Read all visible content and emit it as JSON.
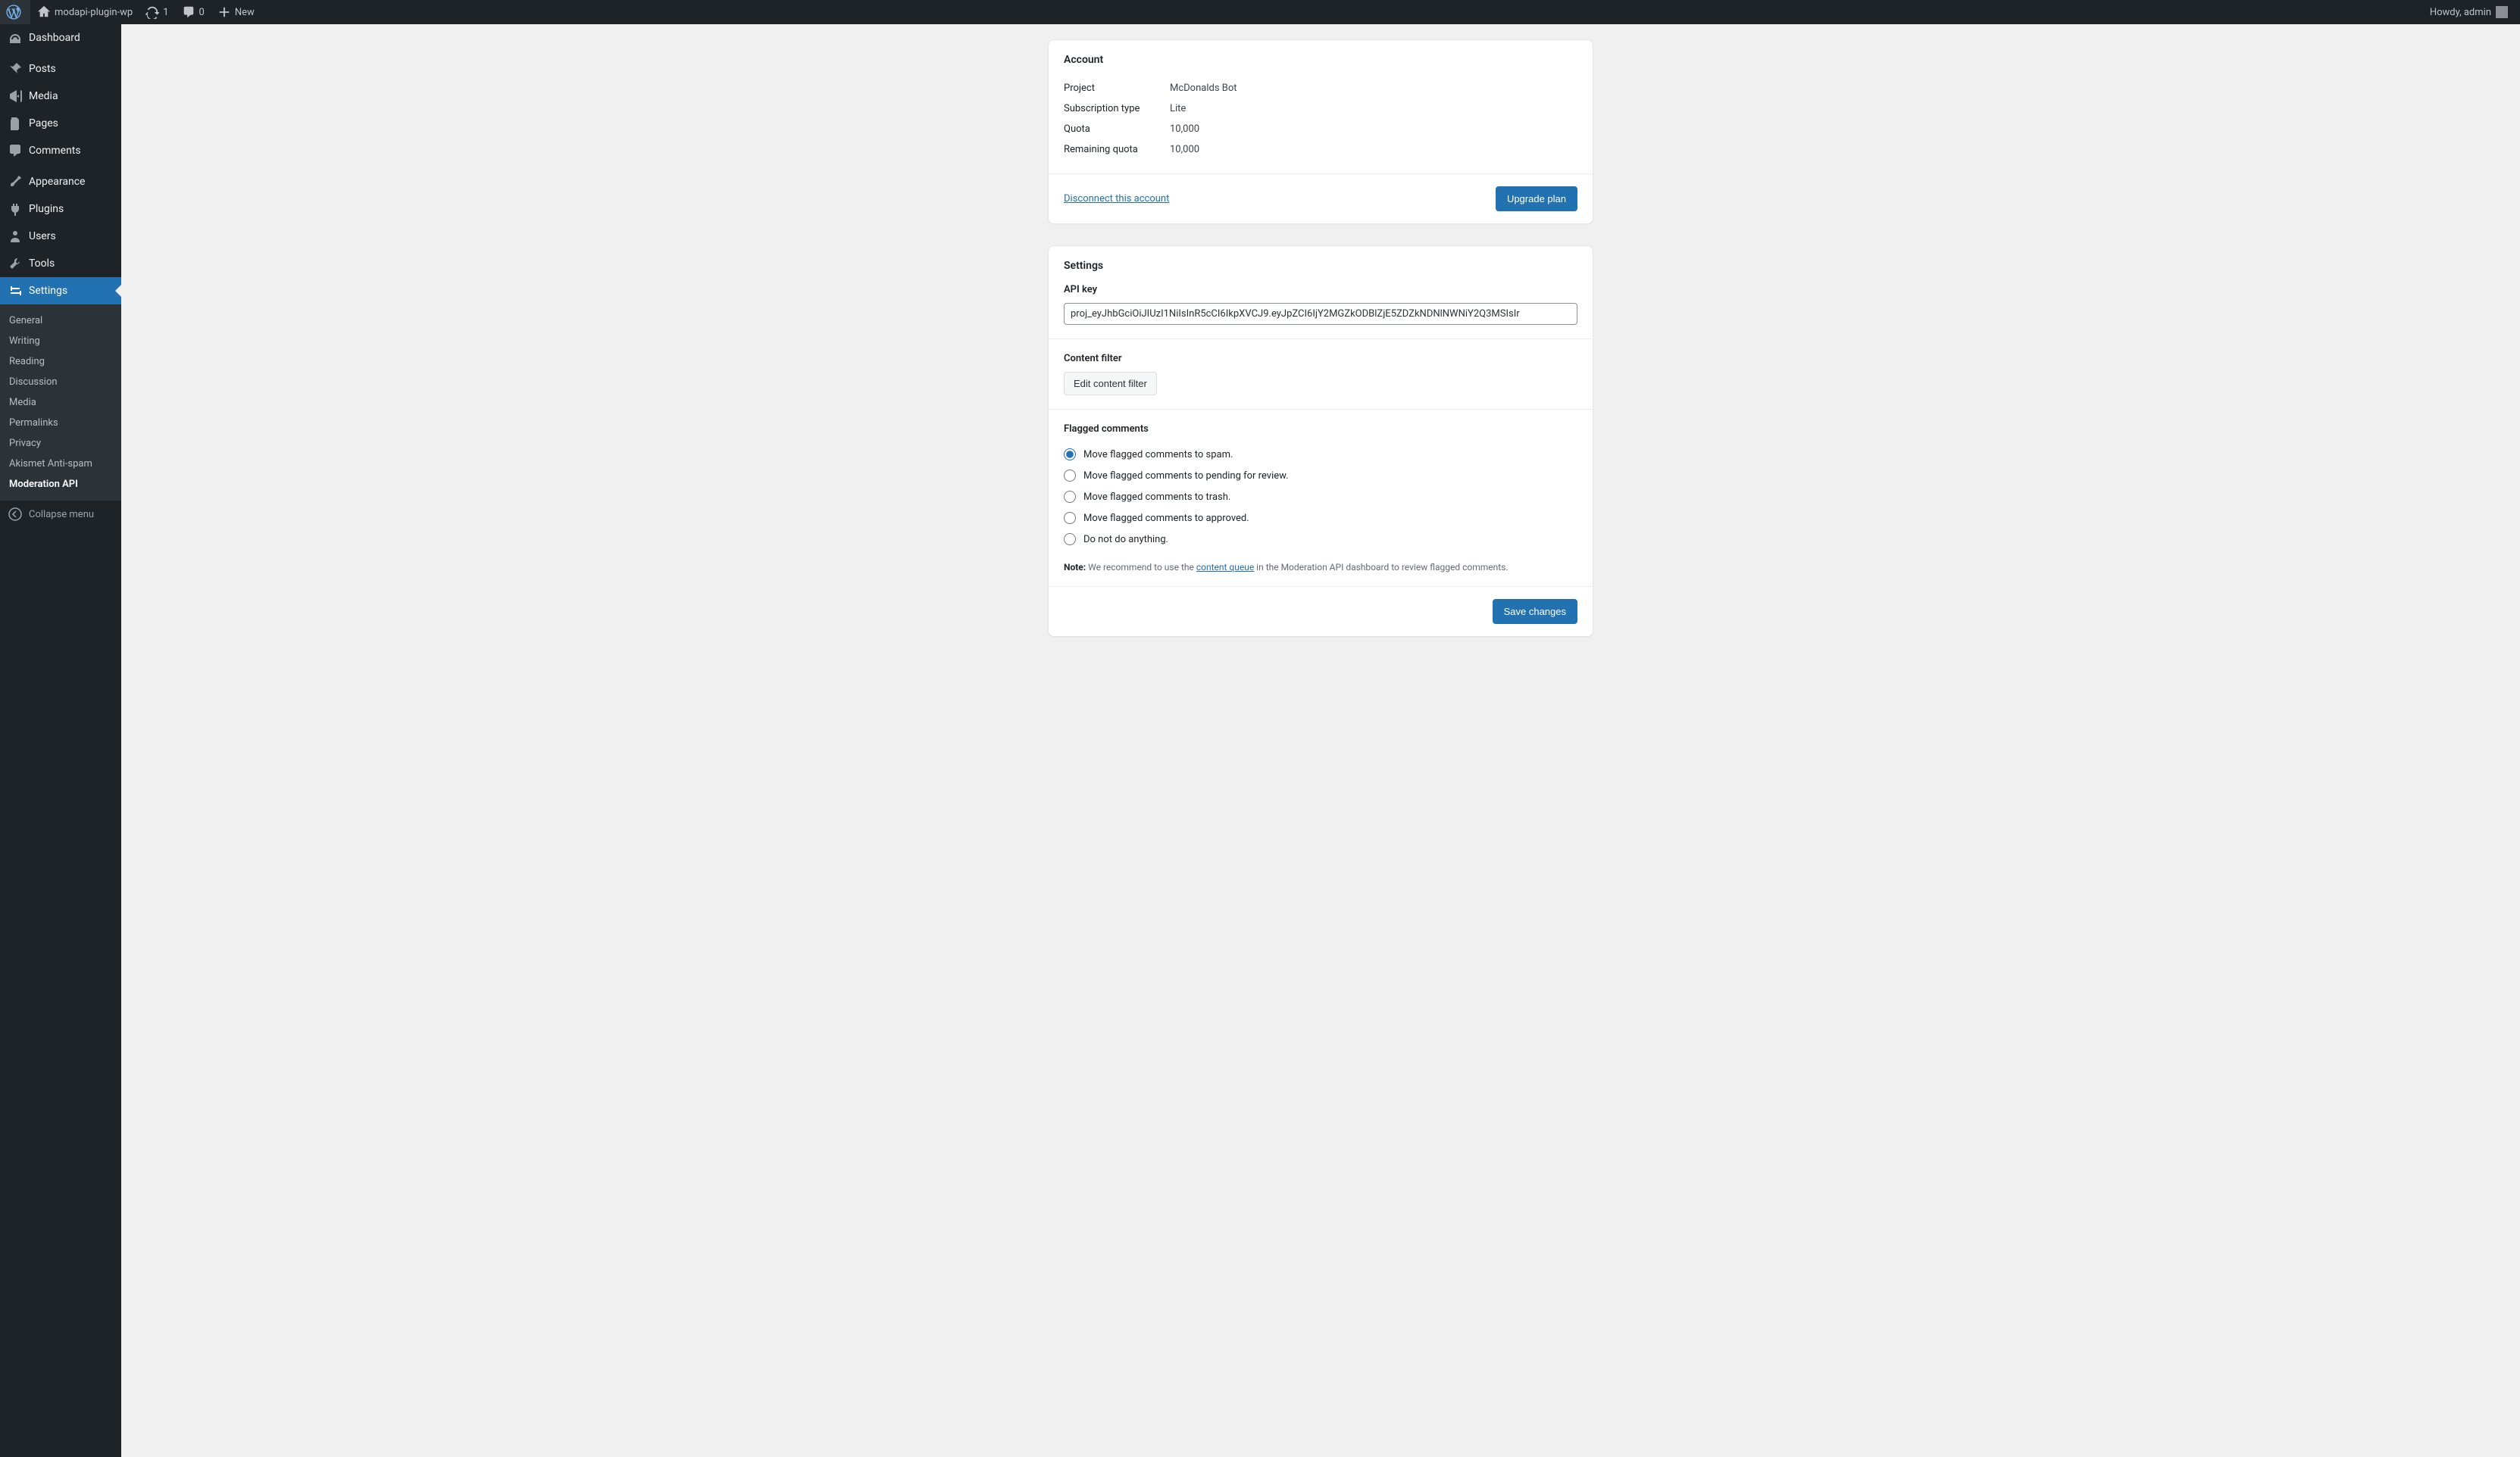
{
  "adminbar": {
    "site_name": "modapi-plugin-wp",
    "updates_count": "1",
    "comments_count": "0",
    "new_label": "New",
    "greeting": "Howdy, admin"
  },
  "sidebar": {
    "items": [
      {
        "label": "Dashboard"
      },
      {
        "label": "Posts"
      },
      {
        "label": "Media"
      },
      {
        "label": "Pages"
      },
      {
        "label": "Comments"
      },
      {
        "label": "Appearance"
      },
      {
        "label": "Plugins"
      },
      {
        "label": "Users"
      },
      {
        "label": "Tools"
      },
      {
        "label": "Settings"
      }
    ],
    "submenu": [
      {
        "label": "General"
      },
      {
        "label": "Writing"
      },
      {
        "label": "Reading"
      },
      {
        "label": "Discussion"
      },
      {
        "label": "Media"
      },
      {
        "label": "Permalinks"
      },
      {
        "label": "Privacy"
      },
      {
        "label": "Akismet Anti-spam"
      },
      {
        "label": "Moderation API"
      }
    ],
    "collapse_label": "Collapse menu"
  },
  "account": {
    "title": "Account",
    "project_label": "Project",
    "project_value": "McDonalds Bot",
    "subtype_label": "Subscription type",
    "subtype_value": "Lite",
    "quota_label": "Quota",
    "quota_value": "10,000",
    "remaining_label": "Remaining quota",
    "remaining_value": "10,000",
    "disconnect_label": "Disconnect this account",
    "upgrade_label": "Upgrade plan"
  },
  "settings": {
    "title": "Settings",
    "apikey_label": "API key",
    "apikey_value": "proj_eyJhbGciOiJIUzI1NiIsInR5cCI6IkpXVCJ9.eyJpZCI6IjY2MGZkODBlZjE5ZDZkNDNlNWNiY2Q3MSIsIr",
    "contentfilter_label": "Content filter",
    "edit_filter_label": "Edit content filter",
    "flagged_label": "Flagged comments",
    "radio_options": [
      "Move flagged comments to spam.",
      "Move flagged comments to pending for review.",
      "Move flagged comments to trash.",
      "Move flagged comments to approved.",
      "Do not do anything."
    ],
    "radio_selected": 0,
    "note_bold": "Note:",
    "note_pre": " We recommend to use the ",
    "note_link": "content queue",
    "note_post": " in the Moderation API dashboard to review flagged comments.",
    "save_label": "Save changes"
  }
}
